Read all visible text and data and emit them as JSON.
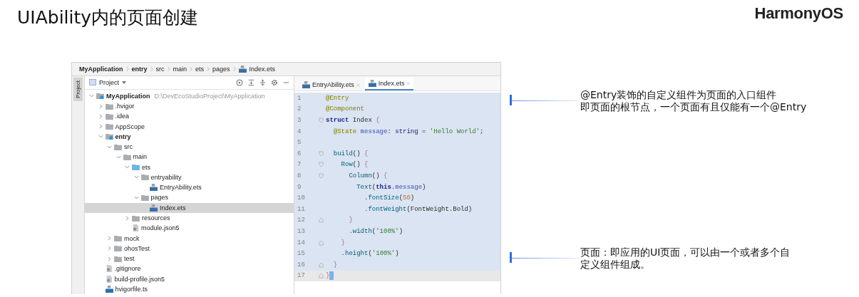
{
  "title": "UIAbility内的页面创建",
  "logo": "HarmonyOS",
  "ide": {
    "breadcrumbs": [
      {
        "label": "MyApplication",
        "bold": true,
        "kind": "folder"
      },
      {
        "label": "entry",
        "bold": true,
        "kind": "folder"
      },
      {
        "label": "src",
        "bold": false,
        "kind": "folder"
      },
      {
        "label": "main",
        "bold": false,
        "kind": "folder"
      },
      {
        "label": "ets",
        "bold": false,
        "kind": "folder"
      },
      {
        "label": "pages",
        "bold": false,
        "kind": "folder"
      },
      {
        "label": "Index.ets",
        "bold": false,
        "kind": "file-ets"
      }
    ],
    "side_tab": "Project",
    "panel": {
      "title": "Project",
      "tree": [
        {
          "label": "MyApplication",
          "path": "D:\\DevEcoStudioProject\\MyApplication",
          "kind": "module",
          "expanded": true,
          "selected": false,
          "children": [
            {
              "label": ".hvigor",
              "kind": "folder",
              "expanded": false,
              "selected": false
            },
            {
              "label": ".idea",
              "kind": "folder",
              "expanded": false,
              "selected": false
            },
            {
              "label": "AppScope",
              "kind": "folder",
              "expanded": false,
              "selected": false
            },
            {
              "label": "entry",
              "kind": "module",
              "expanded": true,
              "selected": false,
              "children": [
                {
                  "label": "src",
                  "kind": "folder",
                  "expanded": true,
                  "selected": false,
                  "children": [
                    {
                      "label": "main",
                      "kind": "folder",
                      "expanded": true,
                      "selected": false,
                      "children": [
                        {
                          "label": "ets",
                          "kind": "source-folder",
                          "expanded": true,
                          "selected": false,
                          "children": [
                            {
                              "label": "entryability",
                              "kind": "folder",
                              "expanded": true,
                              "selected": false,
                              "children": [
                                {
                                  "label": "EntryAbility.ets",
                                  "kind": "file-ets",
                                  "selected": false
                                }
                              ]
                            },
                            {
                              "label": "pages",
                              "kind": "folder",
                              "expanded": true,
                              "selected": false,
                              "children": [
                                {
                                  "label": "Index.ets",
                                  "kind": "file-ets",
                                  "selected": true
                                }
                              ]
                            }
                          ]
                        },
                        {
                          "label": "resources",
                          "kind": "folder",
                          "expanded": false,
                          "selected": false
                        },
                        {
                          "label": "module.json5",
                          "kind": "file-json",
                          "selected": false
                        }
                      ]
                    }
                  ]
                },
                {
                  "label": "mock",
                  "kind": "folder",
                  "expanded": false,
                  "selected": false
                },
                {
                  "label": "ohosTest",
                  "kind": "folder",
                  "expanded": false,
                  "selected": false
                },
                {
                  "label": "test",
                  "kind": "folder",
                  "expanded": false,
                  "selected": false
                }
              ]
            },
            {
              "label": ".gitignore",
              "kind": "file-json",
              "selected": false
            },
            {
              "label": "build-profile.json5",
              "kind": "file-json",
              "selected": false
            },
            {
              "label": "hvigorfile.ts",
              "kind": "file-ts",
              "selected": false
            }
          ]
        }
      ]
    },
    "tabs": [
      {
        "label": "EntryAbility.ets",
        "selected": false
      },
      {
        "label": "Index.ets",
        "selected": true
      }
    ],
    "code": [
      {
        "number": "1",
        "selected": true,
        "current": false,
        "tokens": [
          {
            "text": "@Entry",
            "kind": "annotation"
          }
        ]
      },
      {
        "number": "2",
        "selected": true,
        "current": false,
        "tokens": [
          {
            "text": "@Component",
            "kind": "annotation"
          }
        ]
      },
      {
        "number": "3",
        "selected": true,
        "current": false,
        "fold_open": true,
        "tokens": [
          {
            "text": "struct",
            "kind": "keyword"
          },
          {
            "text": " Index ",
            "kind": "plain"
          },
          {
            "text": "{",
            "kind": "brace"
          }
        ]
      },
      {
        "number": "4",
        "selected": true,
        "current": false,
        "tokens": [
          {
            "text": "  @State",
            "kind": "annotation"
          },
          {
            "text": " message",
            "kind": "field"
          },
          {
            "text": ": ",
            "kind": "plain"
          },
          {
            "text": "string",
            "kind": "type"
          },
          {
            "text": " = ",
            "kind": "plain"
          },
          {
            "text": "'Hello World'",
            "kind": "string"
          },
          {
            "text": ";",
            "kind": "plain"
          }
        ]
      },
      {
        "number": "5",
        "selected": true,
        "current": false
      },
      {
        "number": "6",
        "selected": true,
        "current": false,
        "fold_open": true,
        "tokens": [
          {
            "text": "  build",
            "kind": "call"
          },
          {
            "text": "() ",
            "kind": "plain"
          },
          {
            "text": "{",
            "kind": "brace"
          }
        ]
      },
      {
        "number": "7",
        "selected": true,
        "current": false,
        "fold_open": true,
        "tokens": [
          {
            "text": "    Row",
            "kind": "call"
          },
          {
            "text": "() ",
            "kind": "plain"
          },
          {
            "text": "{",
            "kind": "brace"
          }
        ]
      },
      {
        "number": "8",
        "selected": true,
        "current": false,
        "fold_open": true,
        "tokens": [
          {
            "text": "      Column",
            "kind": "call"
          },
          {
            "text": "() ",
            "kind": "plain"
          },
          {
            "text": "{",
            "kind": "brace"
          }
        ]
      },
      {
        "number": "9",
        "selected": true,
        "current": false,
        "tokens": [
          {
            "text": "        Text",
            "kind": "call"
          },
          {
            "text": "(",
            "kind": "plain"
          },
          {
            "text": "this",
            "kind": "keyword"
          },
          {
            "text": ".",
            "kind": "plain"
          },
          {
            "text": "message",
            "kind": "field"
          },
          {
            "text": ")",
            "kind": "plain"
          }
        ]
      },
      {
        "number": "10",
        "selected": true,
        "current": false,
        "tokens": [
          {
            "text": "          .fontSize",
            "kind": "call"
          },
          {
            "text": "(",
            "kind": "plain"
          },
          {
            "text": "50",
            "kind": "number"
          },
          {
            "text": ")",
            "kind": "plain"
          }
        ]
      },
      {
        "number": "11",
        "selected": true,
        "current": false,
        "tokens": [
          {
            "text": "          .fontWeight",
            "kind": "call"
          },
          {
            "text": "(FontWeight.Bold)",
            "kind": "plain"
          }
        ]
      },
      {
        "number": "12",
        "selected": true,
        "current": false,
        "fold_close": true,
        "tokens": [
          {
            "text": "      }",
            "kind": "brace"
          }
        ]
      },
      {
        "number": "13",
        "selected": true,
        "current": false,
        "tokens": [
          {
            "text": "      .width",
            "kind": "call"
          },
          {
            "text": "(",
            "kind": "plain"
          },
          {
            "text": "'100%'",
            "kind": "string"
          },
          {
            "text": ")",
            "kind": "plain"
          }
        ]
      },
      {
        "number": "14",
        "selected": true,
        "current": false,
        "fold_close": true,
        "tokens": [
          {
            "text": "    }",
            "kind": "brace"
          }
        ]
      },
      {
        "number": "15",
        "selected": true,
        "current": false,
        "tokens": [
          {
            "text": "    .height",
            "kind": "call"
          },
          {
            "text": "(",
            "kind": "plain"
          },
          {
            "text": "'100%'",
            "kind": "string"
          },
          {
            "text": ")",
            "kind": "plain"
          }
        ]
      },
      {
        "number": "16",
        "selected": true,
        "current": false,
        "fold_close": true,
        "tokens": [
          {
            "text": "  }",
            "kind": "brace"
          }
        ]
      },
      {
        "number": "17",
        "selected": false,
        "current": true,
        "fold_close": true,
        "tokens": [
          {
            "text": "}",
            "kind": "brace"
          }
        ]
      }
    ]
  },
  "callouts": [
    {
      "lines": [
        "@Entry装饰的自定义组件为页面的入口组件",
        "即页面的根节点，一个页面有且仅能有一个@Entry"
      ]
    },
    {
      "lines": [
        "页面：即应用的UI页面，可以由一个或者多个自",
        "定义组件组成。"
      ]
    }
  ]
}
